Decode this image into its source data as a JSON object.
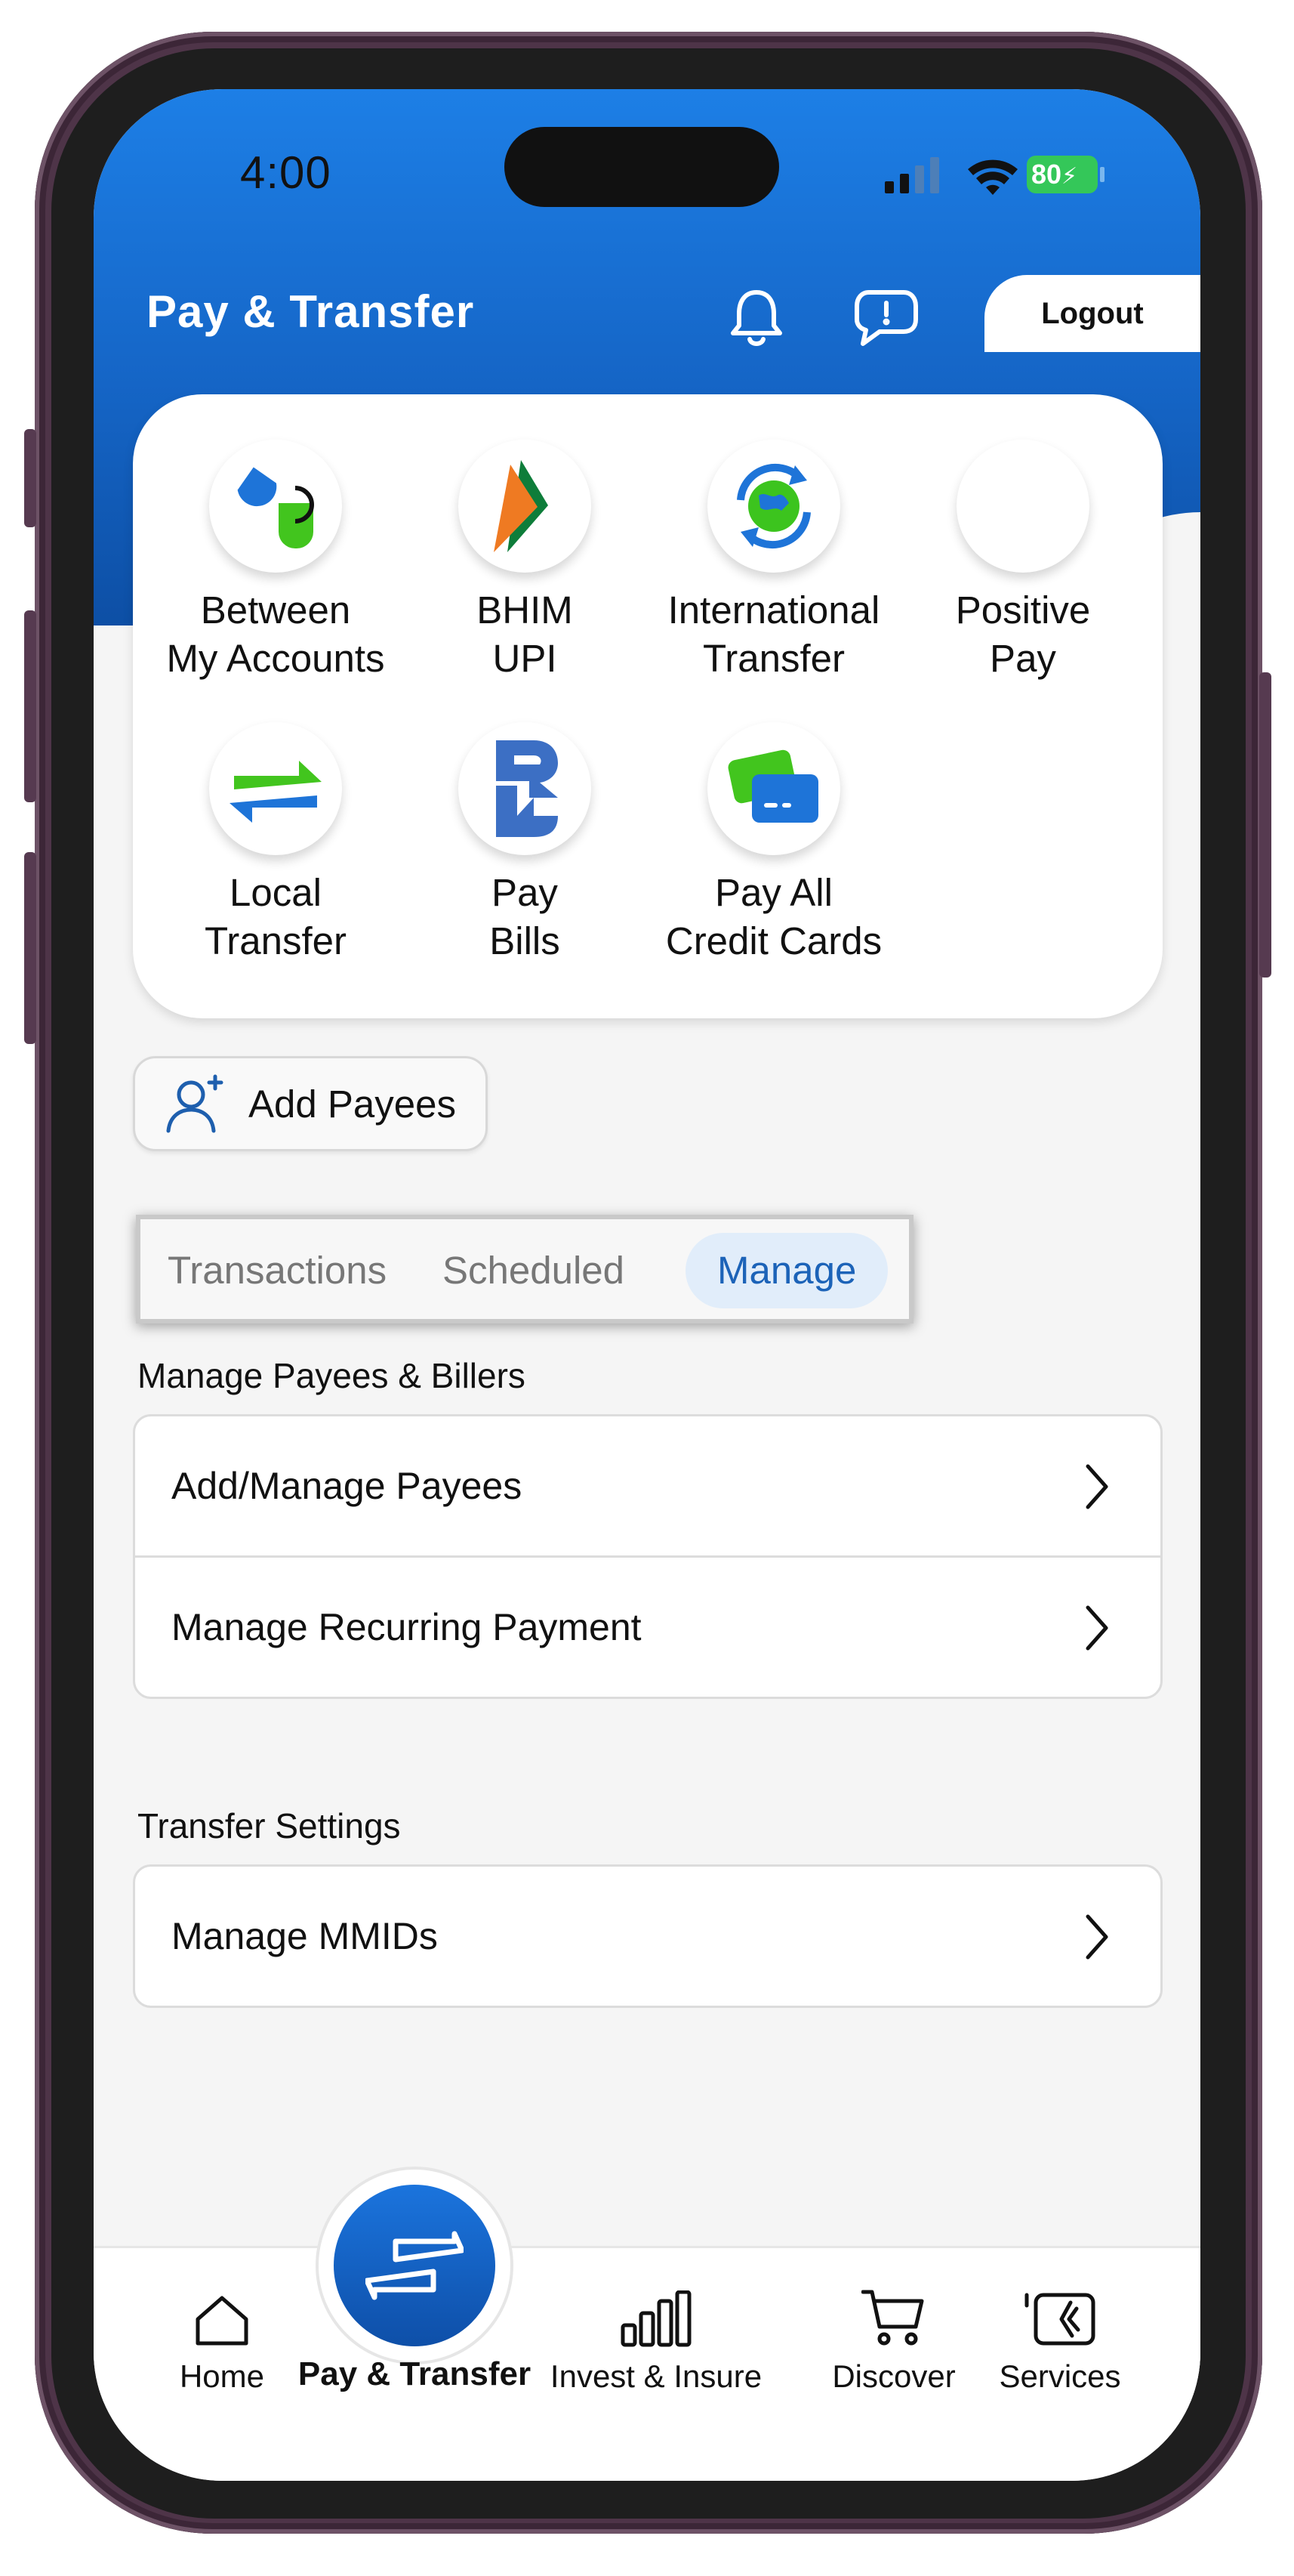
{
  "status_bar": {
    "time": "4:00",
    "battery": "80"
  },
  "header": {
    "title": "Pay & Transfer",
    "logout_label": "Logout"
  },
  "quick_actions": [
    {
      "label": "Between\nMy Accounts",
      "icon": "between-accounts-icon"
    },
    {
      "label": "BHIM\nUPI",
      "icon": "bhim-upi-logo"
    },
    {
      "label": "International\nTransfer",
      "icon": "international-transfer-icon"
    },
    {
      "label": "Positive\nPay",
      "icon": "positive-pay-icon"
    },
    {
      "label": "Local\nTransfer",
      "icon": "local-transfer-icon"
    },
    {
      "label": "Pay\nBills",
      "icon": "bharat-billpay-icon"
    },
    {
      "label": "Pay All\nCredit Cards",
      "icon": "credit-cards-icon"
    }
  ],
  "add_payees_label": "Add Payees",
  "tabs": [
    {
      "label": "Transactions",
      "active": false
    },
    {
      "label": "Scheduled",
      "active": false
    },
    {
      "label": "Manage",
      "active": true
    }
  ],
  "manage_section": {
    "title": "Manage Payees & Billers",
    "items": [
      "Add/Manage Payees",
      "Manage Recurring Payment"
    ]
  },
  "settings_section": {
    "title": "Transfer Settings",
    "items": [
      "Manage MMIDs"
    ]
  },
  "bottom_nav": [
    {
      "label": "Home",
      "icon": "home-icon",
      "active": false
    },
    {
      "label": "Pay & Transfer",
      "icon": "transfer-arrows-icon",
      "active": true
    },
    {
      "label": "Invest & Insure",
      "icon": "bar-chart-icon",
      "active": false
    },
    {
      "label": "Discover",
      "icon": "cart-icon",
      "active": false
    },
    {
      "label": "Services",
      "icon": "services-icon",
      "active": false
    }
  ],
  "colors": {
    "primary_blue": "#1565c6",
    "accent_green": "#34c759",
    "active_tab_bg": "#e1edfa",
    "active_tab_text": "#1c63b8"
  }
}
